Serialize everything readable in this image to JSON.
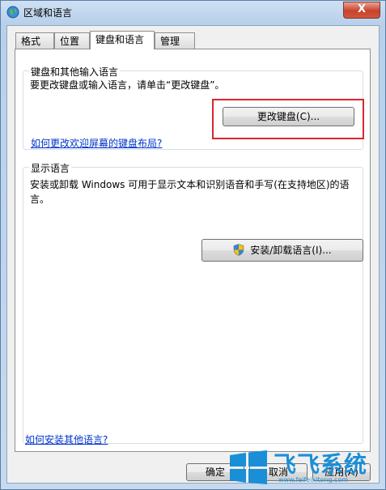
{
  "window": {
    "title": "区域和语言",
    "close_label": "X"
  },
  "tabs": [
    {
      "label": "格式",
      "active": false
    },
    {
      "label": "位置",
      "active": false
    },
    {
      "label": "键盘和语言",
      "active": true
    },
    {
      "label": "管理",
      "active": false
    }
  ],
  "keyboard_group": {
    "title": "键盘和其他输入语言",
    "description": "要更改键盘或输入语言，请单击“更改键盘”。",
    "change_keyboard_button": "更改键盘(C)...",
    "welcome_layout_link": "如何更改欢迎屏幕的键盘布局?"
  },
  "display_group": {
    "title": "显示语言",
    "description": "安装或卸载 Windows 可用于显示文本和识别语音和手写(在支持地区)的语言。",
    "install_button": "安装/卸载语言(I)..."
  },
  "bottom_link": "如何安装其他语言?",
  "footer": {
    "ok": "确定",
    "cancel": "取消",
    "apply": "应用(A)"
  },
  "watermark": {
    "text": "飞飞系统",
    "url": "www.feifeixitong.com"
  },
  "colors": {
    "highlight": "#d8262c",
    "link": "#0033cc"
  }
}
